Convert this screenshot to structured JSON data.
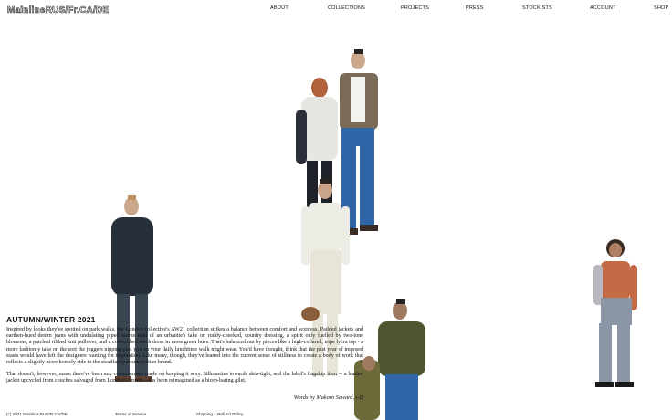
{
  "header": {
    "logo": "MainlineRUS/Fr.CA/DE"
  },
  "nav": {
    "about": "ABOUT",
    "collections": "COLLECTIONS",
    "projects": "PROJECTS",
    "press": "PRESS",
    "stockists": "STOCKISTS",
    "account": "ACCOUNT",
    "shop": "SHOP"
  },
  "article": {
    "title": "AUTUMN/WINTER 2021",
    "paragraph_1": "Inspired by looks they've spotted on park walks, the London collective's AW21 collection strikes a balance between comfort and sexiness. Padded jackets and earthen-hued denim jeans with undulating piped seams read of an urbanite's take on ruddy-cheeked, country dressing, a spirit only fuelled by two-tone blousons, a patched ribbed knit pullover, and a cobwebbed mesh dress in moss green hues. That's balanced out by pieces like a high-collared, tripe lycra top - a more fashion-y take on the sort the joggers nipping past you on your daily lunchtime walk might wear. You'd have thought, think that the past year of imposed stasis would have left the designers wanting for inspiration. Like many, though, they've leaned into the current sense of stillness to create a body of work that reflects a slightly more homely side to the steadfastly cosmopolitan brand.",
    "paragraph_2": "That doesn't, however, mean there've been any compromises made on keeping it sexy. Silhouettes towards skin-tight, and the label's flagship item -- a leather jacket upcycled from couches salvaged from London's streets --has been reimagined as a bicep-baring gilet.",
    "credit": "Words by Makoro Seward, i-D"
  },
  "footer": {
    "copyright_prefix": "(c) 2021 ",
    "copyright_brand": "Mainline",
    "copyright_suffix": ":RUS/Fr.CA/DE",
    "terms": "Terms of Service",
    "shipping": "Shipping + Refund Policy"
  },
  "colors": {
    "background": "#ffffff",
    "text": "#111111",
    "denim_blue": "#2f66a8",
    "rust": "#b0623c",
    "olive": "#5b5a2c"
  }
}
